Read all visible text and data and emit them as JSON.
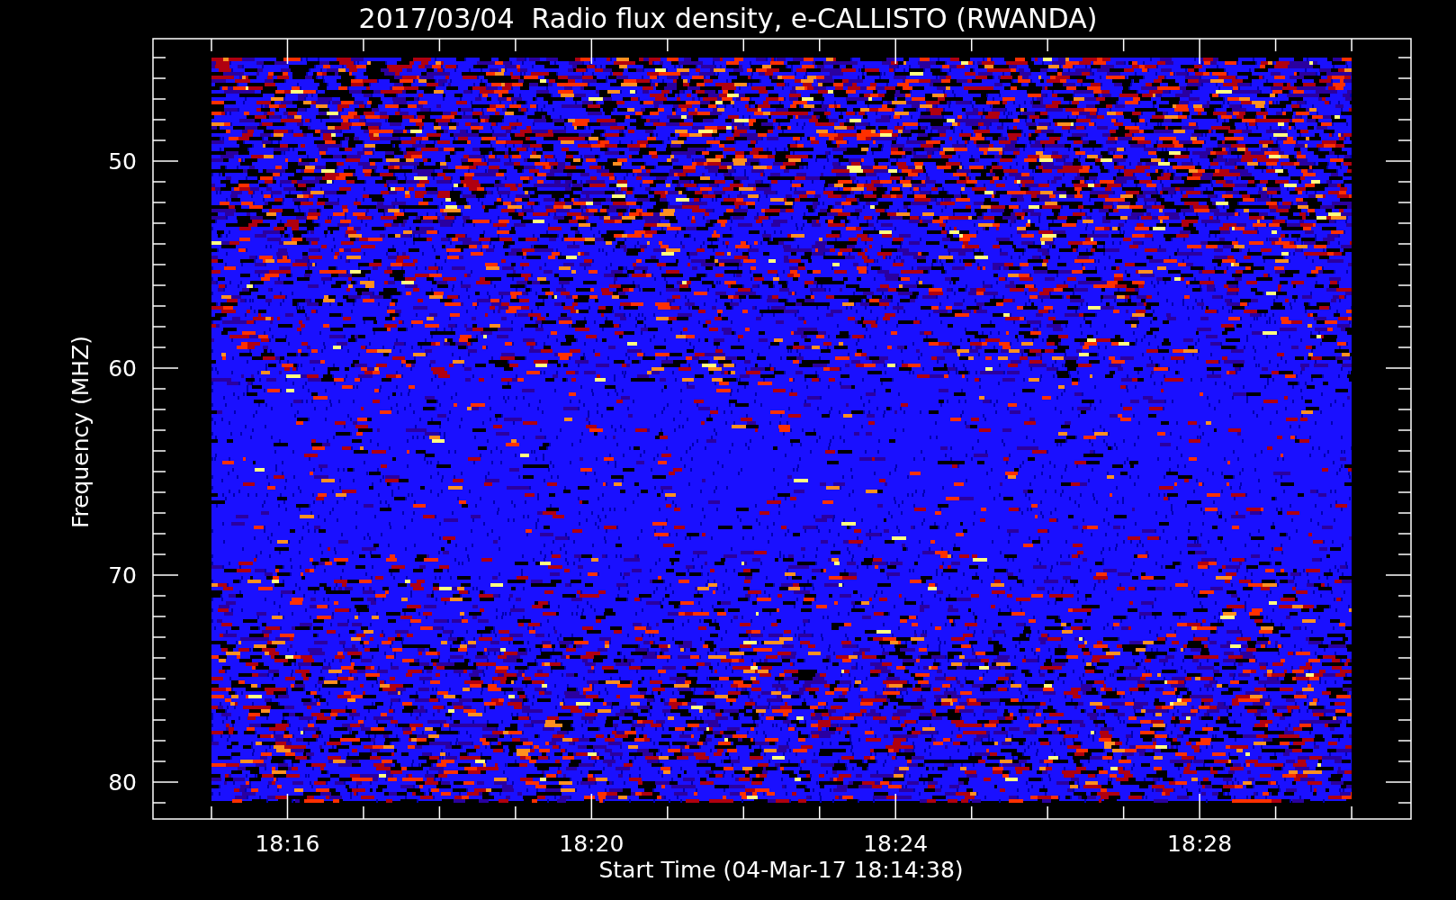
{
  "title": "2017/03/04  Radio flux density, e-CALLISTO (RWANDA)",
  "ylabel": "Frequency (MHZ)",
  "xlabel": "Start Time (04-Mar-17 18:14:38)",
  "y_ticks": [
    "50",
    "60",
    "70",
    "80"
  ],
  "x_ticks": [
    "18:16",
    "18:20",
    "18:24",
    "18:28"
  ]
}
